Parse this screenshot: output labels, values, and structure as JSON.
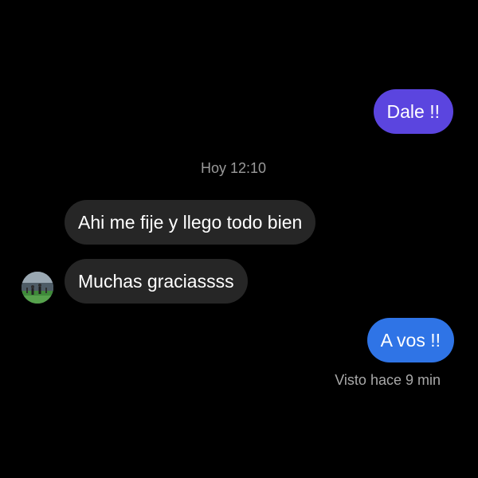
{
  "conversation": {
    "messages": [
      {
        "sender": "me",
        "text": "Dale !!"
      },
      {
        "sender": "contact",
        "text": "Ahi me fije y llego todo bien"
      },
      {
        "sender": "contact",
        "text": "Muchas graciassss"
      },
      {
        "sender": "me",
        "text": "A vos !!"
      }
    ],
    "timestamp": "Hoy 12:10",
    "seen_status": "Visto hace 9 min"
  },
  "colors": {
    "background": "#000000",
    "outgoing_bubble_1": "#5b45df",
    "outgoing_bubble_2": "#2f74e6",
    "incoming_bubble": "#262626",
    "meta_text": "#9a9a9a"
  },
  "icons": {
    "contact_avatar": "contact-avatar-photo"
  }
}
